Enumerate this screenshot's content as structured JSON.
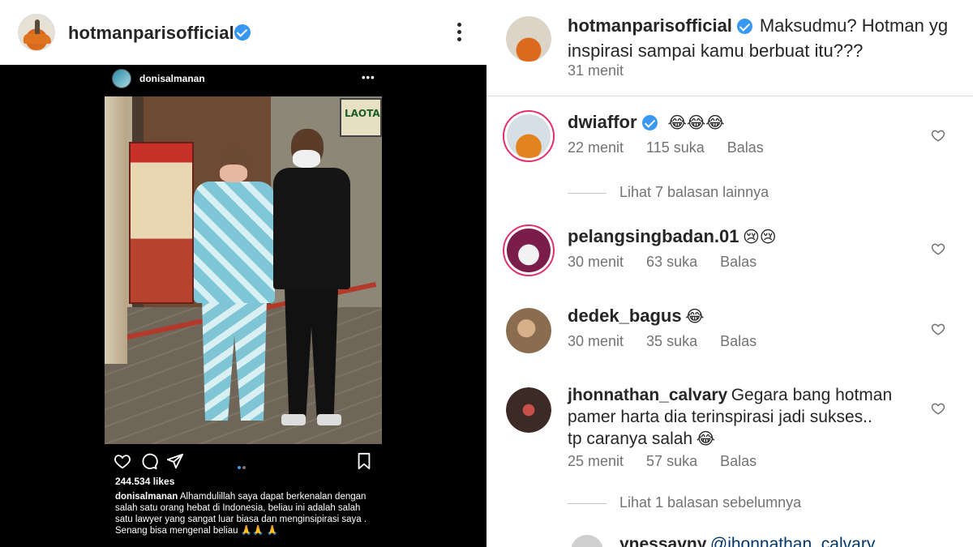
{
  "left": {
    "header": {
      "username": "hotmanparisofficial",
      "more_icon": "more-vertical-icon"
    },
    "post": {
      "username": "donisalmanan",
      "more": "•••",
      "likes": "244.534 likes",
      "caption_user": "donisalmanan",
      "caption_text": "Alhamdulillah saya dapat berkenalan dengan salah satu orang hebat di Indonesia, beliau ini adalah salah satu lawyer yang sangat luar biasa dan menginsipirasi saya . Senang bisa mengenal beliau 🙏🙏 🙏",
      "photo_sign": "LAOTA"
    }
  },
  "right": {
    "main_comment": {
      "username": "hotmanparisofficial",
      "text": "Maksudmu? Hotman yg inspirasi sampai kamu berbuat itu???",
      "time": "31 menit"
    },
    "comments": [
      {
        "username": "dwiaffor",
        "verified": true,
        "text": "😂😂😂",
        "time": "22 menit",
        "likes": "115 suka",
        "reply": "Balas"
      },
      {
        "username": "pelangsingbadan.01",
        "verified": false,
        "text": "😢😢",
        "time": "30 menit",
        "likes": "63 suka",
        "reply": "Balas"
      },
      {
        "username": "dedek_bagus",
        "verified": false,
        "text": "😂",
        "time": "30 menit",
        "likes": "35 suka",
        "reply": "Balas"
      },
      {
        "username": "jhonnathan_calvary",
        "verified": false,
        "text_line1": "Gegara bang hotman",
        "text_line2": "pamer harta dia terinspirasi jadi sukses..",
        "text_line3": "tp caranya salah",
        "emoji": "😂",
        "time": "25 menit",
        "likes": "57 suka",
        "reply": "Balas"
      }
    ],
    "view_more_1": "Lihat 7 balasan lainnya",
    "view_more_2": "Lihat 1 balasan sebelumnya",
    "partial_comment": {
      "username": "ynessavny",
      "text": "@jhonnathan_calvary"
    }
  }
}
